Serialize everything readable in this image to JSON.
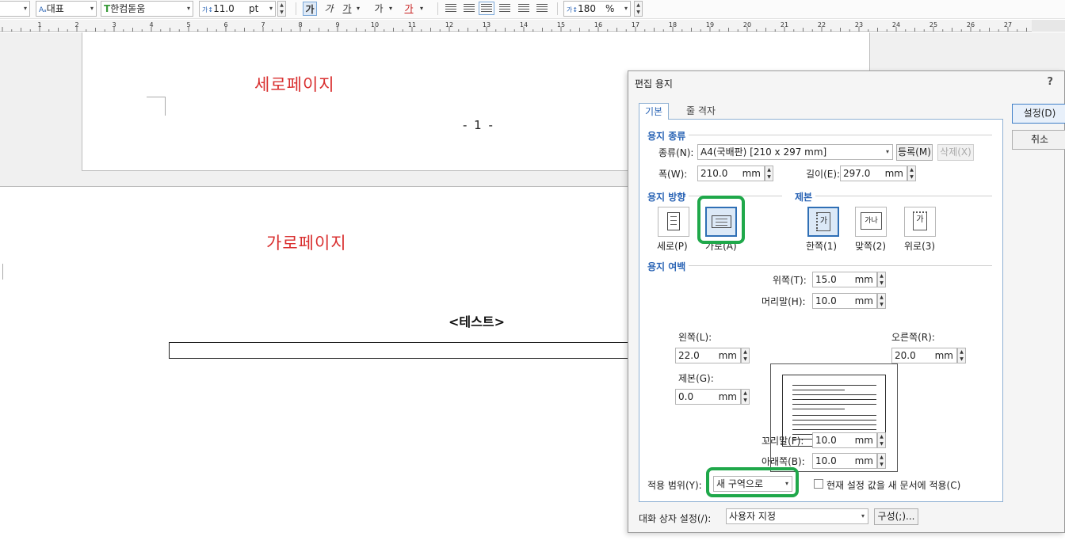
{
  "toolbar": {
    "style_value": "대표",
    "font_value": "한컴돋움",
    "size_value": "11.0",
    "size_unit": "pt",
    "bold_label": "가",
    "italic_label": "가",
    "underline_label": "가",
    "strike_label": "가",
    "color_label": "가",
    "spacing_value": "180",
    "spacing_unit": "%"
  },
  "ruler": {
    "ticks": [
      "1",
      "2",
      "3",
      "4",
      "5",
      "6",
      "7",
      "8",
      "9",
      "10",
      "11",
      "12",
      "13",
      "14",
      "15",
      "16",
      "17",
      "18",
      "19",
      "20",
      "21",
      "22",
      "23",
      "24",
      "25",
      "26",
      "27"
    ]
  },
  "document": {
    "page1_title": "세로페이지",
    "page_number": "- 1 -",
    "page2_title": "가로페이지",
    "test_label": "<테스트>"
  },
  "dialog": {
    "title": "편집 용지",
    "help": "?",
    "tabs": [
      "기본",
      "줄 격자"
    ],
    "paper_type_section": "용지 종류",
    "type_label": "종류(N):",
    "type_value": "A4(국배판)  [210 x 297 mm]",
    "register_button": "등록(M)",
    "delete_button": "삭제(X)",
    "width_label": "폭(W):",
    "width_value": "210.0",
    "height_label": "길이(E):",
    "height_value": "297.0",
    "unit_mm": "mm",
    "orientation_section": "용지 방향",
    "portrait_label": "세로(P)",
    "landscape_label": "가로(A)",
    "binding_section": "제본",
    "binding_single": "한쪽(1)",
    "binding_facing": "맞쪽(2)",
    "binding_top": "위로(3)",
    "binding_icon_glyph": "가",
    "binding_icon_glyph2": "가나",
    "margin_section": "용지 여백",
    "top_label": "위쪽(T):",
    "top_value": "15.0",
    "header_label": "머리말(H):",
    "header_value": "10.0",
    "left_label": "왼쪽(L):",
    "left_value": "22.0",
    "right_label": "오른쪽(R):",
    "right_value": "20.0",
    "gutter_label": "제본(G):",
    "gutter_value": "0.0",
    "footer_label": "꼬리말(F):",
    "footer_value": "10.0",
    "bottom_label": "아래쪽(B):",
    "bottom_value": "10.0",
    "apply_label": "적용 범위(Y):",
    "apply_value": "새 구역으로",
    "apply_new_doc_label": "현재 설정 값을 새 문서에 적용(C)",
    "ok_button": "설정(D)",
    "cancel_button": "취소",
    "dialog_setting_label": "대화 상자 설정(/):",
    "dialog_setting_value": "사용자 지정",
    "config_button": "구성(;)...",
    "highlight_color": "#1fa84a",
    "accent_color": "#2a64b5"
  }
}
